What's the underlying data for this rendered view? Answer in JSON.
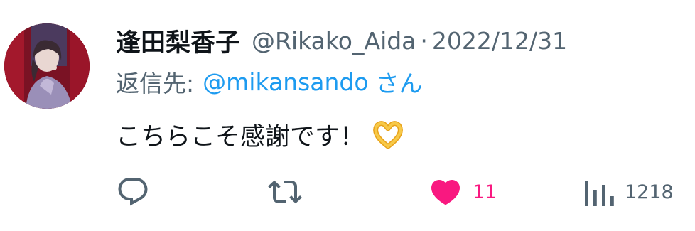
{
  "tweet": {
    "display_name": "逢田梨香子",
    "handle": "@Rikako_Aida",
    "separator": "·",
    "date": "2022/12/31",
    "reply_prefix": "返信先:",
    "reply_user": "@mikansando",
    "reply_suffix": "さん",
    "body": "こちらこそ感謝です！",
    "emoji": "heart-hands-emoji"
  },
  "actions": {
    "reply_icon": "reply-icon",
    "retweet_icon": "retweet-icon",
    "like_icon": "heart-filled-icon",
    "like_count": "11",
    "views_icon": "views-icon",
    "views_count": "1218"
  },
  "colors": {
    "text": "#0f1419",
    "secondary": "#536471",
    "link": "#1d9bf0",
    "like": "#f91880"
  }
}
